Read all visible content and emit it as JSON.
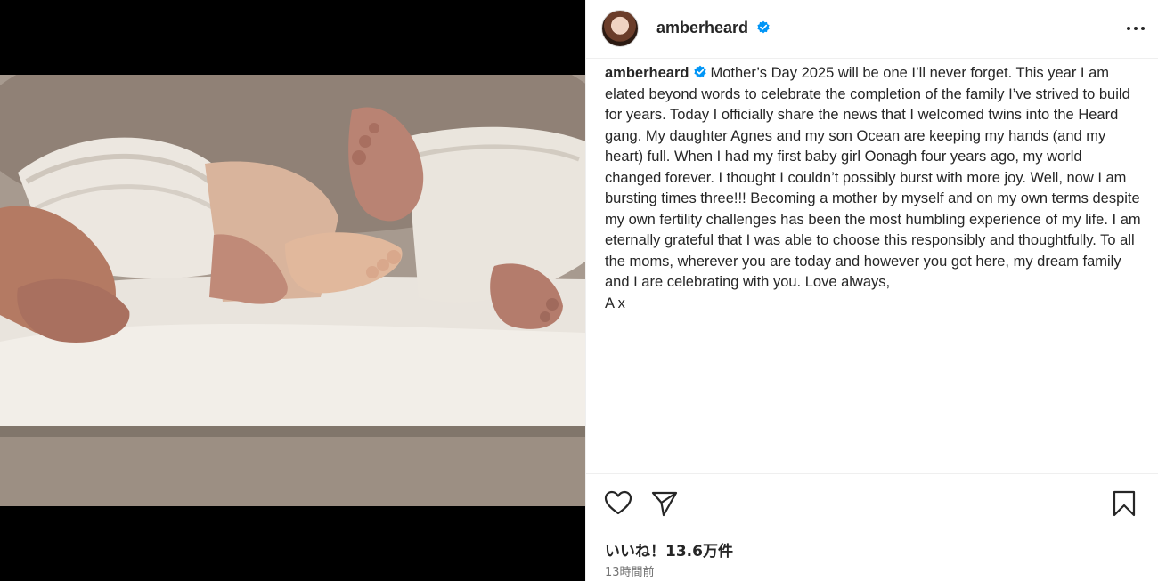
{
  "post": {
    "username": "amberheard",
    "verified": true,
    "caption_username": "amberheard",
    "caption_text": "Mother’s Day 2025 will be one I’ll never forget. This year I am elated beyond words to celebrate the completion of the family I’ve strived to build for years. Today I officially share the news that I welcomed twins into the Heard gang. My daughter Agnes and my son Ocean are keeping my hands (and my heart) full. When I had my first baby girl Oonagh four years ago, my world changed forever. I thought I couldn’t possibly burst with more joy. Well, now I am bursting times three!!! Becoming a mother by myself and on my own terms despite my own fertility challenges has been the most humbling experience of my life. I am eternally grateful that I was able to choose this responsibly and thoughtfully. To all the moms, wherever you are today and however you got here, my dream family and I are celebrating with you. Love always,",
    "caption_signoff": "A x",
    "likes_label": "いいね！13.6万件",
    "timestamp": "13時間前"
  },
  "icons": {
    "more": "more-horizontal-icon",
    "like": "heart-icon",
    "share": "paper-plane-icon",
    "save": "bookmark-icon",
    "verified": "verified-badge-icon"
  },
  "colors": {
    "verified_blue": "#0095f6",
    "text": "#262626",
    "muted": "#737373",
    "divider": "#efefef"
  }
}
